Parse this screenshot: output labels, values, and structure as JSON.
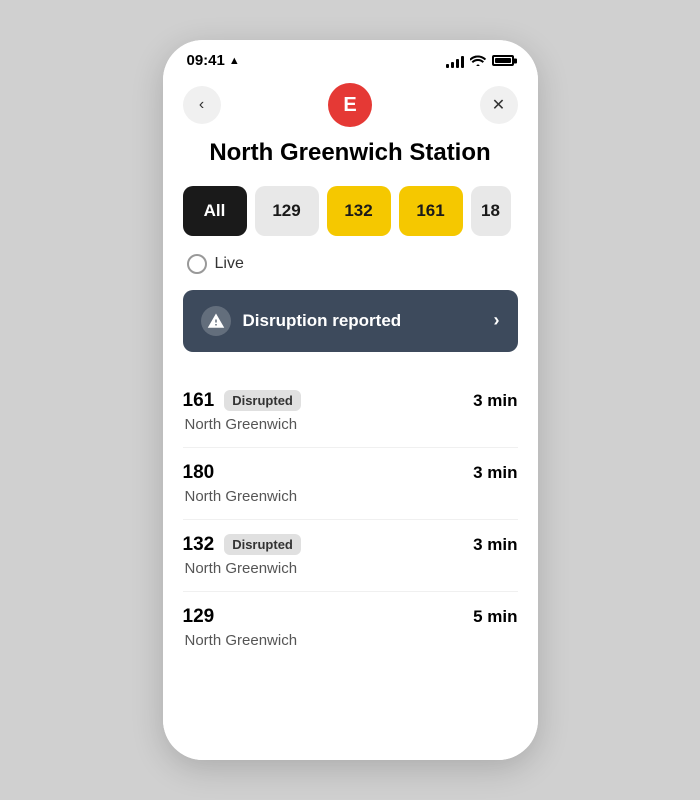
{
  "statusBar": {
    "time": "09:41",
    "locationArrow": "➤"
  },
  "nav": {
    "backLabel": "‹",
    "avatarLabel": "E",
    "closeLabel": "✕"
  },
  "station": {
    "title": "North Greenwich Station"
  },
  "filters": [
    {
      "label": "All",
      "style": "active-black"
    },
    {
      "label": "129",
      "style": "inactive"
    },
    {
      "label": "132",
      "style": "yellow"
    },
    {
      "label": "161",
      "style": "yellow"
    },
    {
      "label": "18",
      "style": "partial"
    }
  ],
  "live": {
    "label": "Live"
  },
  "disruption": {
    "text": "Disruption reported",
    "chevron": "›"
  },
  "busList": [
    {
      "number": "161",
      "disrupted": true,
      "disruptedLabel": "Disrupted",
      "destination": "North Greenwich",
      "time": "3 min"
    },
    {
      "number": "180",
      "disrupted": false,
      "disruptedLabel": "",
      "destination": "North Greenwich",
      "time": "3 min"
    },
    {
      "number": "132",
      "disrupted": true,
      "disruptedLabel": "Disrupted",
      "destination": "North Greenwich",
      "time": "3 min"
    },
    {
      "number": "129",
      "disrupted": false,
      "disruptedLabel": "",
      "destination": "North Greenwich",
      "time": "5 min"
    }
  ]
}
